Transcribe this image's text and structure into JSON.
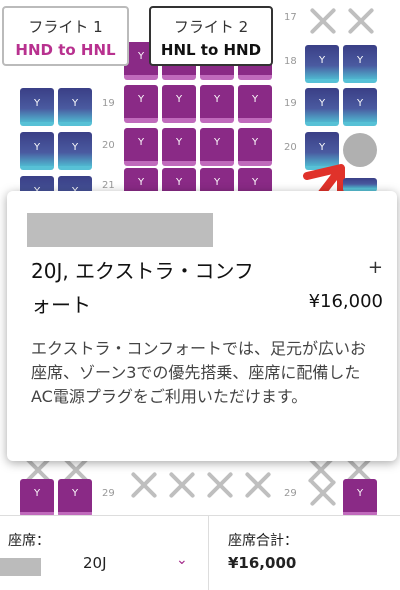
{
  "flights": [
    {
      "label": "フライト 1",
      "route": "HND to HNL"
    },
    {
      "label": "フライト 2",
      "route": "HNL to HND"
    }
  ],
  "seat_badge_letter": "Y",
  "row_numbers": {
    "r17": "17",
    "r18": "18",
    "r19_left": "19",
    "r19_right": "19",
    "r20_left": "20",
    "r20_right": "20",
    "r21": "21",
    "r29_left": "29",
    "r29_right": "29"
  },
  "popup": {
    "title_line1": "20J, エクストラ・コンフ",
    "title_line2": "ォート",
    "plus": "+",
    "price": "¥16,000",
    "description": "エクストラ・コンフォートでは、足元が広いお座席、ゾーン3での優先搭乗、座席に配備したAC電源プラグをご利用いただけます。"
  },
  "footer": {
    "seat_label": "座席：",
    "seat_value": "20J",
    "chevron": "⌄",
    "total_label": "座席合計：",
    "total_value": "¥16,000"
  },
  "colors": {
    "accent": "#b8318f",
    "extra_comfort": "#8a2a86",
    "economy": "#3a3f86"
  }
}
